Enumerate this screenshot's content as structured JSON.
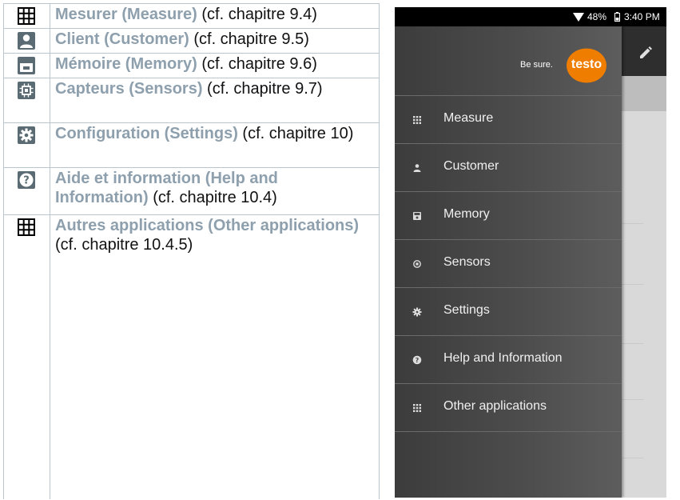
{
  "doc": {
    "rows": [
      {
        "icon": "grid-icon",
        "term": "Mesurer (Measure)",
        "ref": " (cf. chapitre 9.4)"
      },
      {
        "icon": "person-icon",
        "term": "Client (Customer)",
        "ref": " (cf. chapitre 9.5)"
      },
      {
        "icon": "floppy-disk-icon",
        "term": "Mémoire (Memory)",
        "ref": " (cf. chapitre 9.6)"
      },
      {
        "icon": "chip-icon",
        "term": "Capteurs (Sensors)",
        "ref": " (cf. chapitre 9.7)"
      },
      {
        "icon": "gear-icon",
        "term": "Configuration (Settings)",
        "ref": " (cf. chapitre 10)"
      },
      {
        "icon": "help-icon",
        "term": "Aide et information (Help and Information)",
        "ref": " (cf. chapitre 10.4)"
      },
      {
        "icon": "grid-icon",
        "term": "Autres applications (Other applications)",
        "ref": " (cf. chapitre 10.4.5)"
      }
    ]
  },
  "phone": {
    "status": {
      "battery": "48%",
      "time": "3:40 PM"
    },
    "tagline": "Be sure.",
    "logo": "testo",
    "brand_color": "#ef7d00",
    "menu": [
      {
        "icon": "grid-icon",
        "label": "Measure"
      },
      {
        "icon": "person-icon",
        "label": "Customer"
      },
      {
        "icon": "floppy-disk-icon",
        "label": "Memory"
      },
      {
        "icon": "chip-icon",
        "label": "Sensors"
      },
      {
        "icon": "gear-icon",
        "label": "Settings"
      },
      {
        "icon": "help-icon",
        "label": "Help and Information"
      },
      {
        "icon": "grid-icon",
        "label": "Other applications"
      }
    ]
  }
}
